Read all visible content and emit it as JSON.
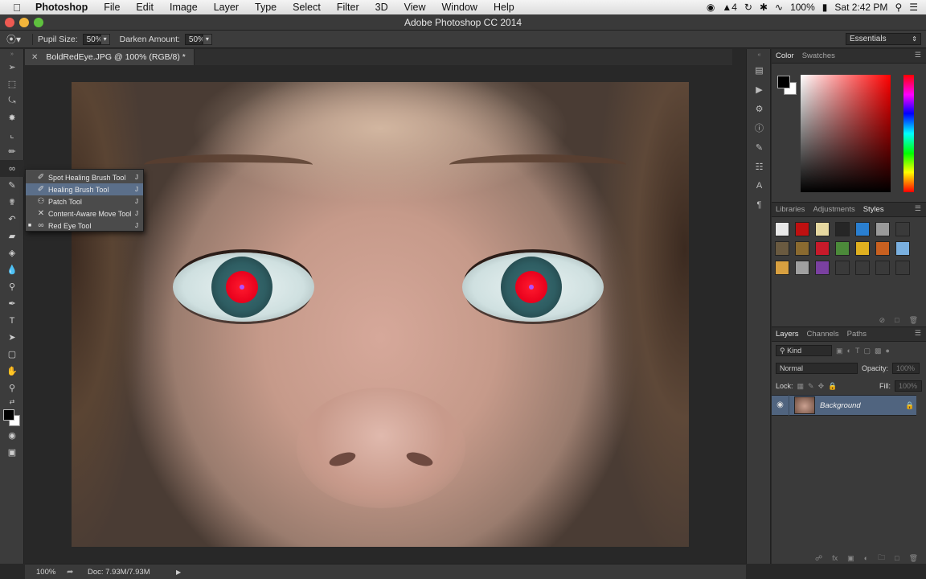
{
  "menubar": {
    "app_name": "Photoshop",
    "items": [
      "File",
      "Edit",
      "Image",
      "Layer",
      "Type",
      "Select",
      "Filter",
      "3D",
      "View",
      "Window",
      "Help"
    ],
    "status": {
      "adobe_count": "4",
      "battery": "100%",
      "clock": "Sat 2:42 PM"
    }
  },
  "window": {
    "title": "Adobe Photoshop CC 2014"
  },
  "options_bar": {
    "pupil_size_label": "Pupil Size:",
    "pupil_size_value": "50%",
    "darken_amount_label": "Darken Amount:",
    "darken_amount_value": "50%",
    "workspace": "Essentials"
  },
  "document": {
    "tab_title": "BoldRedEye.JPG @ 100% (RGB/8) *",
    "zoom": "100%",
    "doc_size": "Doc: 7.93M/7.93M"
  },
  "tool_flyout": {
    "items": [
      {
        "label": "Spot Healing Brush Tool",
        "shortcut": "J",
        "active": false
      },
      {
        "label": "Healing Brush Tool",
        "shortcut": "J",
        "active": false
      },
      {
        "label": "Patch Tool",
        "shortcut": "J",
        "active": false
      },
      {
        "label": "Content-Aware Move Tool",
        "shortcut": "J",
        "active": false
      },
      {
        "label": "Red Eye Tool",
        "shortcut": "J",
        "active": true
      }
    ]
  },
  "color_panel": {
    "tabs": [
      "Color",
      "Swatches"
    ],
    "active_tab": "Color",
    "foreground": "#000000",
    "background": "#ffffff"
  },
  "styles_panel": {
    "tabs": [
      "Libraries",
      "Adjustments",
      "Styles"
    ],
    "active_tab": "Styles",
    "swatch_colors": [
      "#e8e8e8",
      "#c01010",
      "#e6d8a0",
      "#262626",
      "#2a7fd0",
      "#9a9a9a",
      "#3a3a3a",
      "#6a5a40",
      "#8a6a30",
      "#c81a2a",
      "#4c8a3a",
      "#e0b020",
      "#c86020",
      "#7ab0e0",
      "#d8a040",
      "#a0a0a0",
      "#7a40a0",
      "#3a3a3a",
      "#3a3a3a",
      "#3a3a3a",
      "#3a3a3a"
    ]
  },
  "layers_panel": {
    "tabs": [
      "Layers",
      "Channels",
      "Paths"
    ],
    "active_tab": "Layers",
    "filter": "Kind",
    "blend_mode": "Normal",
    "opacity_label": "Opacity:",
    "opacity_value": "100%",
    "lock_label": "Lock:",
    "fill_label": "Fill:",
    "fill_value": "100%",
    "layers": [
      {
        "name": "Background",
        "visible": true,
        "locked": true
      }
    ]
  }
}
